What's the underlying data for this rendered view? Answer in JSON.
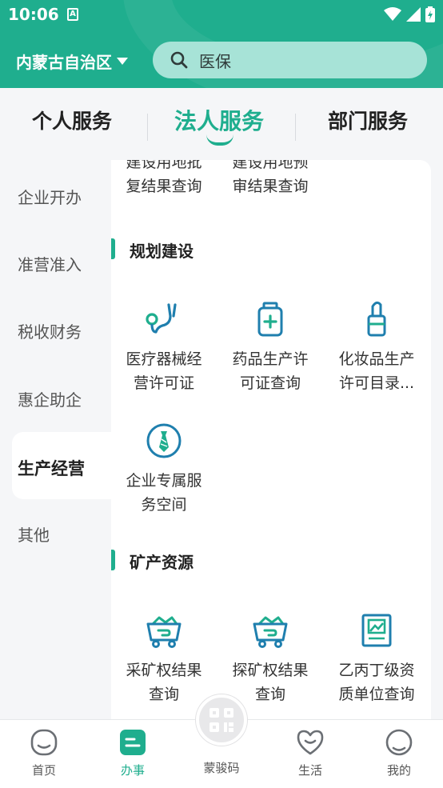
{
  "status": {
    "time": "10:06",
    "notif": "A"
  },
  "header": {
    "region": "内蒙古自治区",
    "search_placeholder": "医保"
  },
  "tabs": [
    {
      "label": "个人服务"
    },
    {
      "label": "法人服务"
    },
    {
      "label": "部门服务"
    }
  ],
  "categories": [
    {
      "label": "企业开办"
    },
    {
      "label": "准营准入"
    },
    {
      "label": "税收财务"
    },
    {
      "label": "惠企助企"
    },
    {
      "label": "生产经营"
    },
    {
      "label": "其他"
    }
  ],
  "partial_items": [
    {
      "line1": "建设用地批",
      "line2": "复结果查询"
    },
    {
      "line1": "建设用地预",
      "line2": "审结果查询"
    }
  ],
  "sections": [
    {
      "title": "规划建设",
      "items": [
        {
          "label": "医疗器械经营许可证",
          "icon": "stethoscope-icon"
        },
        {
          "label": "药品生产许可证查询",
          "icon": "medicine-bottle-icon"
        },
        {
          "label": "化妆品生产许可目录...",
          "icon": "lipstick-icon"
        },
        {
          "label": "企业专属服务空间",
          "icon": "tie-icon"
        }
      ]
    },
    {
      "title": "矿产资源",
      "items": [
        {
          "label": "采矿权结果查询",
          "icon": "mine-cart-icon"
        },
        {
          "label": "探矿权结果查询",
          "icon": "mine-cart-icon"
        },
        {
          "label": "乙丙丁级资质单位查询",
          "icon": "certificate-icon"
        }
      ]
    }
  ],
  "bottom_nav": [
    {
      "label": "首页"
    },
    {
      "label": "办事"
    },
    {
      "label": "蒙骏码"
    },
    {
      "label": "生活"
    },
    {
      "label": "我的"
    }
  ],
  "colors": {
    "accent": "#1fae8e",
    "header_bg": "#1fae8e",
    "search_bg": "#a7e3d7"
  }
}
